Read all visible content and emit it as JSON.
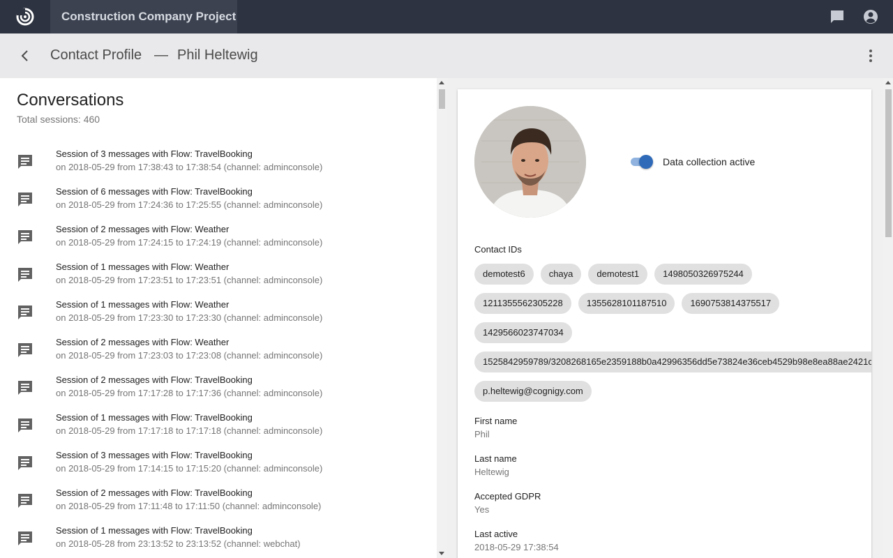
{
  "app": {
    "project_name": "Construction Company Project",
    "logo_icon": "cognigy-logo-icon",
    "chat_icon": "chat-icon",
    "account_icon": "account-circle-icon"
  },
  "header": {
    "title": "Contact Profile",
    "separator": "—",
    "contact_name": "Phil Heltewig",
    "back_icon": "arrow-back-icon",
    "more_icon": "more-vert-icon"
  },
  "conversations": {
    "title": "Conversations",
    "total": "Total sessions: 460",
    "sessions": [
      {
        "title": "Session of 3 messages with Flow: TravelBooking",
        "detail": "on 2018-05-29 from 17:38:43 to 17:38:54 (channel: adminconsole)"
      },
      {
        "title": "Session of 6 messages with Flow: TravelBooking",
        "detail": "on 2018-05-29 from 17:24:36 to 17:25:55 (channel: adminconsole)"
      },
      {
        "title": "Session of 2 messages with Flow: Weather",
        "detail": "on 2018-05-29 from 17:24:15 to 17:24:19 (channel: adminconsole)"
      },
      {
        "title": "Session of 1 messages with Flow: Weather",
        "detail": "on 2018-05-29 from 17:23:51 to 17:23:51 (channel: adminconsole)"
      },
      {
        "title": "Session of 1 messages with Flow: Weather",
        "detail": "on 2018-05-29 from 17:23:30 to 17:23:30 (channel: adminconsole)"
      },
      {
        "title": "Session of 2 messages with Flow: Weather",
        "detail": "on 2018-05-29 from 17:23:03 to 17:23:08 (channel: adminconsole)"
      },
      {
        "title": "Session of 2 messages with Flow: TravelBooking",
        "detail": "on 2018-05-29 from 17:17:28 to 17:17:36 (channel: adminconsole)"
      },
      {
        "title": "Session of 1 messages with Flow: TravelBooking",
        "detail": "on 2018-05-29 from 17:17:18 to 17:17:18 (channel: adminconsole)"
      },
      {
        "title": "Session of 3 messages with Flow: TravelBooking",
        "detail": "on 2018-05-29 from 17:14:15 to 17:15:20 (channel: adminconsole)"
      },
      {
        "title": "Session of 2 messages with Flow: TravelBooking",
        "detail": "on 2018-05-29 from 17:11:48 to 17:11:50 (channel: adminconsole)"
      },
      {
        "title": "Session of 1 messages with Flow: TravelBooking",
        "detail": "on 2018-05-28 from 23:13:52 to 23:13:52 (channel: webchat)"
      }
    ]
  },
  "profile": {
    "data_collection_label": "Data collection active",
    "data_collection_on": true,
    "contact_ids_label": "Contact IDs",
    "contact_ids": [
      [
        "demotest6",
        "chaya",
        "demotest1",
        "1498050326975244"
      ],
      [
        "1211355562305228",
        "1355628101187510",
        "1690753814375517"
      ],
      [
        "1429566023747034"
      ],
      [
        "1525842959789/3208268165e2359188b0a42996356dd5e73824e36ceb4529b98e8ea88ae2421c"
      ],
      [
        "p.heltewig@cognigy.com"
      ]
    ],
    "first_name_label": "First name",
    "first_name": "Phil",
    "last_name_label": "Last name",
    "last_name": "Heltewig",
    "gdpr_label": "Accepted GDPR",
    "gdpr": "Yes",
    "last_active_label": "Last active",
    "last_active": "2018-05-29 17:38:54"
  },
  "colors": {
    "topbar": "#2d3340",
    "project_tab": "#3c4250",
    "subheader": "#e9e9eb",
    "toggle_accent": "#2e6ab8",
    "chip": "#e0e0e0"
  }
}
